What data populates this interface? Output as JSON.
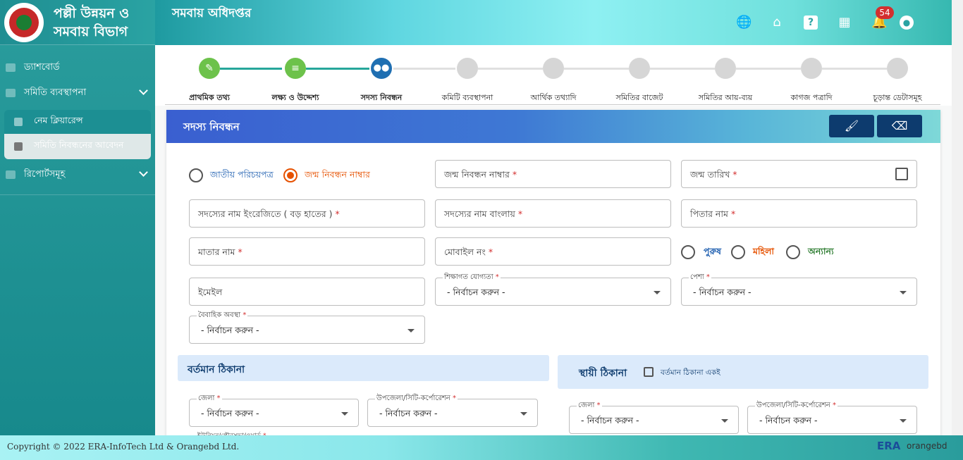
{
  "sidebar": {
    "brand_line1": "পল্লী উন্নয়ন ও",
    "brand_line2": "সমবায় বিভাগ",
    "items": [
      {
        "label": "ড্যাশবোর্ড"
      },
      {
        "label": "সমিতি ব্যবস্থাপনা"
      },
      {
        "label": "নেম ক্লিয়ারেন্স"
      },
      {
        "label": "সমিতি নিবন্ধনের আবেদন"
      },
      {
        "label": "রিপোর্টসমূহ"
      }
    ]
  },
  "header": {
    "title": "সমবায় অধিদপ্তর",
    "notification_count": "54",
    "icons": [
      "globe-icon",
      "home-icon",
      "help-icon",
      "dashboard-icon",
      "bell-icon",
      "account-icon"
    ]
  },
  "steps": [
    {
      "label": "প্রাথমিক তথ্য",
      "status": "done"
    },
    {
      "label": "লক্ষ্য ও উদ্দেশ্য",
      "status": "done"
    },
    {
      "label": "সদস্য নিবন্ধন",
      "status": "active"
    },
    {
      "label": "কমিটি ব্যবস্থাপনা",
      "status": "pending"
    },
    {
      "label": "আর্থিক তথ্যাদি",
      "status": "pending"
    },
    {
      "label": "সমিতির বাজেট",
      "status": "pending"
    },
    {
      "label": "সমিতির আয়-ব্যয়",
      "status": "pending"
    },
    {
      "label": "কাগজ পত্রাদি",
      "status": "pending"
    },
    {
      "label": "চূড়ান্ত ডেটাসমূহ",
      "status": "pending"
    }
  ],
  "card": {
    "title": "সদস্য নিবন্ধন"
  },
  "form": {
    "id_type_nid": "জাতীয় পরিচয়পত্র",
    "id_type_birth": "জন্ম নিবন্ধন নাম্বার",
    "birth_reg_no": "জন্ম নিবন্ধন নাম্বার",
    "dob": "জন্ম তারিখ",
    "name_en": "সদস্যের নাম ইংরেজিতে ( বড় হাতের )",
    "name_bn": "সদস্যের নাম বাংলায়",
    "father": "পিতার নাম",
    "mother": "মাতার নাম",
    "mobile": "মোবাইল নং",
    "gender_male": "পুরুষ",
    "gender_female": "মহিলা",
    "gender_other": "অন্যান্য",
    "email": "ইমেইল",
    "education_label": "শিক্ষাগত যোগ্যতা",
    "profession_label": "পেশা",
    "marital_label": "বৈবাহিক অবস্থা",
    "select_placeholder": "- নির্বাচন করুন -",
    "required_mark": "*"
  },
  "address": {
    "present_title": "বর্তমান ঠিকানা",
    "permanent_title": "স্থায়ী ঠিকানা",
    "same_as_present": "বর্তমান ঠিকানা একই",
    "district_label": "জেলা",
    "upazila_label": "উপজেলা/সিটি-কর্পোরেশন",
    "union_label": "ইউনিয়ন/পৌরসভা/ওয়ার্ড"
  },
  "footer": {
    "copyright": "Copyright © 2022 ERA-InfoTech Ltd & Orangebd Ltd.",
    "logo1": "ERA",
    "logo2": "orangebd"
  }
}
